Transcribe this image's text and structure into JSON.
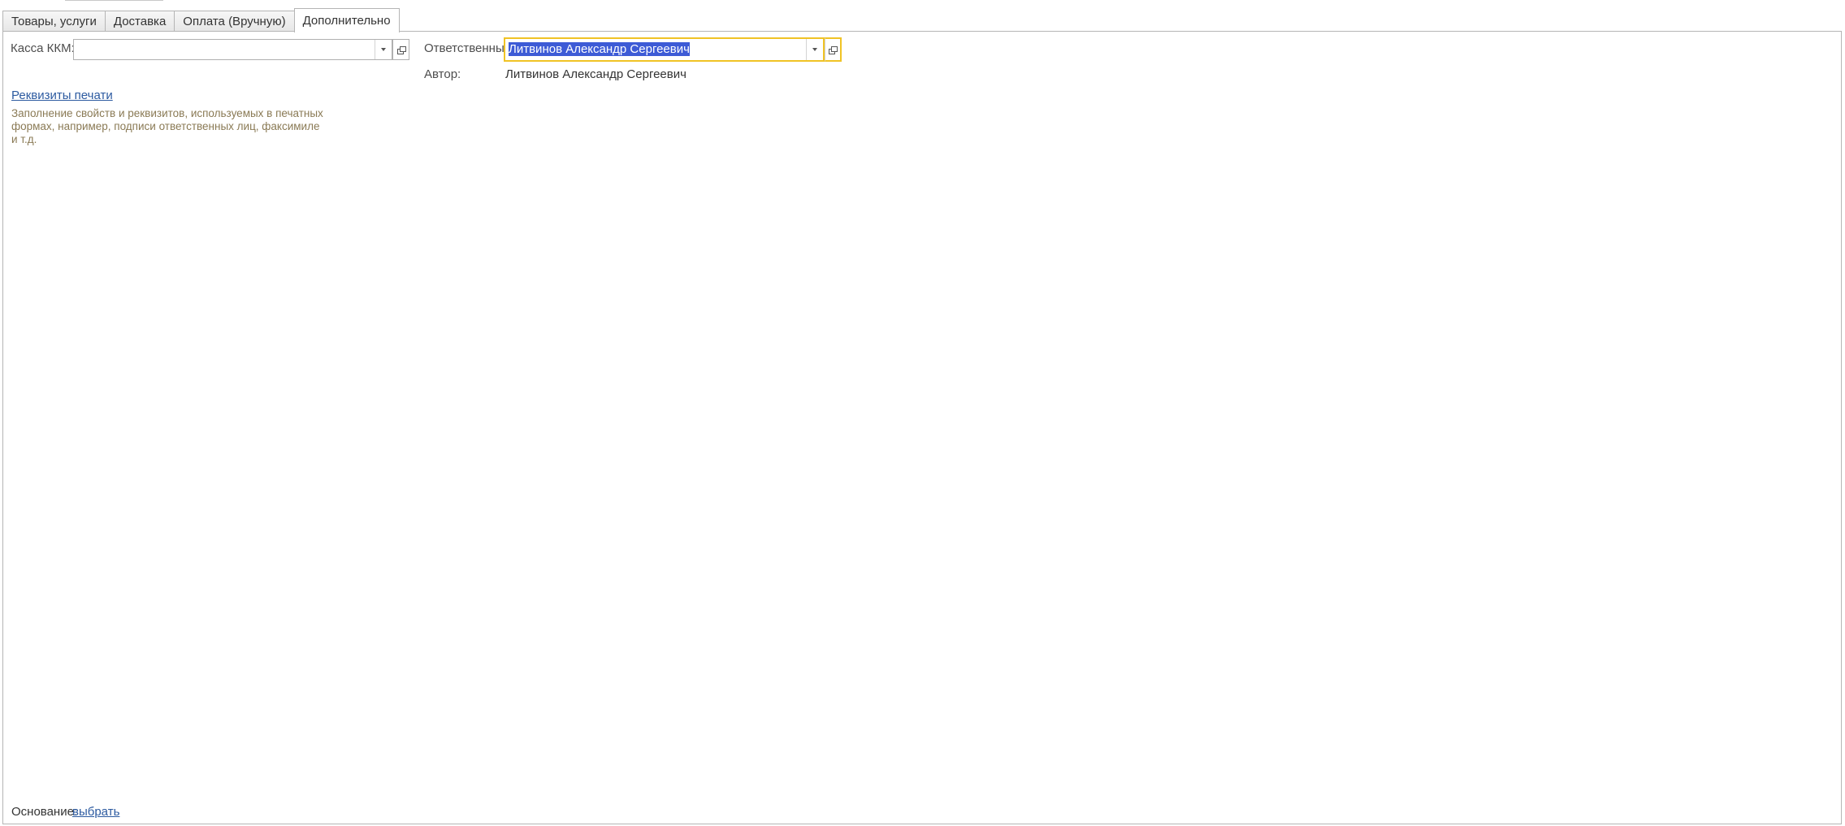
{
  "tabs": [
    {
      "label": "Товары, услуги",
      "active": false
    },
    {
      "label": "Доставка",
      "active": false
    },
    {
      "label": "Оплата (Вручную)",
      "active": false
    },
    {
      "label": "Дополнительно",
      "active": true
    }
  ],
  "kassa": {
    "label": "Касса ККМ:",
    "value": ""
  },
  "responsible": {
    "label": "Ответственный:",
    "value": "Литвинов Александр Сергеевич"
  },
  "author": {
    "label": "Автор:",
    "value": "Литвинов Александр Сергеевич"
  },
  "print_details": {
    "link": "Реквизиты печати",
    "hint": "Заполнение свойств и реквизитов, используемых в печатных формах, например, подписи ответственных лиц, факсимиле и т.д."
  },
  "basis": {
    "label": "Основание:",
    "link": "выбрать"
  },
  "colors": {
    "focus_border": "#f0c325",
    "selection": "#3d5bd6",
    "link": "#2c5aa0",
    "hint_text": "#8a7a55"
  },
  "icons": {
    "dropdown": "chevron-down-icon",
    "open": "open-form-icon"
  }
}
